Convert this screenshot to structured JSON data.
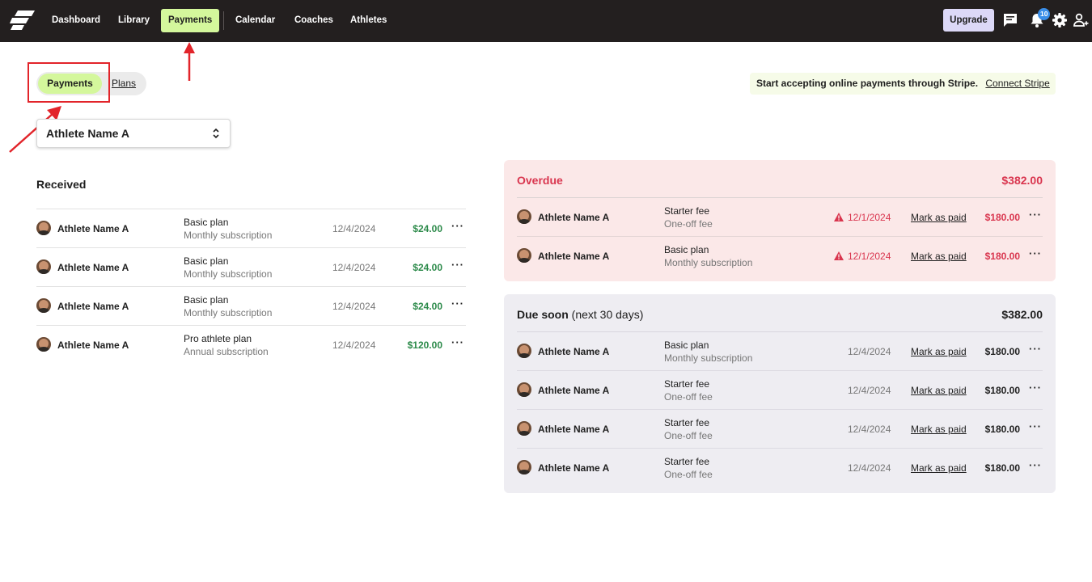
{
  "nav": {
    "items": [
      "Dashboard",
      "Library",
      "Payments",
      "Calendar",
      "Coaches",
      "Athletes"
    ],
    "active": "Payments",
    "upgrade_label": "Upgrade",
    "notification_count": "10"
  },
  "tabs": {
    "payments_label": "Payments",
    "plans_label": "Plans"
  },
  "stripe": {
    "message": "Start accepting online payments through Stripe.",
    "link": "Connect Stripe"
  },
  "athlete_select": {
    "value": "Athlete Name A"
  },
  "received": {
    "title": "Received",
    "rows": [
      {
        "name": "Athlete Name A",
        "plan": "Basic plan",
        "sub": "Monthly subscription",
        "date": "12/4/2024",
        "amount": "$24.00"
      },
      {
        "name": "Athlete Name A",
        "plan": "Basic plan",
        "sub": "Monthly subscription",
        "date": "12/4/2024",
        "amount": "$24.00"
      },
      {
        "name": "Athlete Name A",
        "plan": "Basic plan",
        "sub": "Monthly subscription",
        "date": "12/4/2024",
        "amount": "$24.00"
      },
      {
        "name": "Athlete Name A",
        "plan": "Pro athlete plan",
        "sub": "Annual subscription",
        "date": "12/4/2024",
        "amount": "$120.00"
      }
    ]
  },
  "overdue": {
    "title": "Overdue",
    "total": "$382.00",
    "rows": [
      {
        "name": "Athlete Name A",
        "plan": "Starter fee",
        "sub": "One-off fee",
        "date": "12/1/2024",
        "action": "Mark as paid",
        "amount": "$180.00"
      },
      {
        "name": "Athlete Name A",
        "plan": "Basic plan",
        "sub": "Monthly subscription",
        "date": "12/1/2024",
        "action": "Mark as paid",
        "amount": "$180.00"
      }
    ]
  },
  "due_soon": {
    "title": "Due soon",
    "note": "(next 30 days)",
    "total": "$382.00",
    "rows": [
      {
        "name": "Athlete Name A",
        "plan": "Basic plan",
        "sub": "Monthly subscription",
        "date": "12/4/2024",
        "action": "Mark as paid",
        "amount": "$180.00"
      },
      {
        "name": "Athlete Name A",
        "plan": "Starter fee",
        "sub": "One-off fee",
        "date": "12/4/2024",
        "action": "Mark as paid",
        "amount": "$180.00"
      },
      {
        "name": "Athlete Name A",
        "plan": "Starter fee",
        "sub": "One-off fee",
        "date": "12/4/2024",
        "action": "Mark as paid",
        "amount": "$180.00"
      },
      {
        "name": "Athlete Name A",
        "plan": "Starter fee",
        "sub": "One-off fee",
        "date": "12/4/2024",
        "action": "Mark as paid",
        "amount": "$180.00"
      }
    ]
  },
  "more_label": "···",
  "colors": {
    "nav_bg": "#231f1f",
    "accent_green": "#d4f79c",
    "received_amount": "#2c8a4a",
    "overdue_red": "#d9354e",
    "overdue_panel": "#fbe8e8",
    "due_panel": "#eeedf2",
    "upgrade_bg": "#dcd8f7",
    "annotation_red": "#e2242a"
  }
}
